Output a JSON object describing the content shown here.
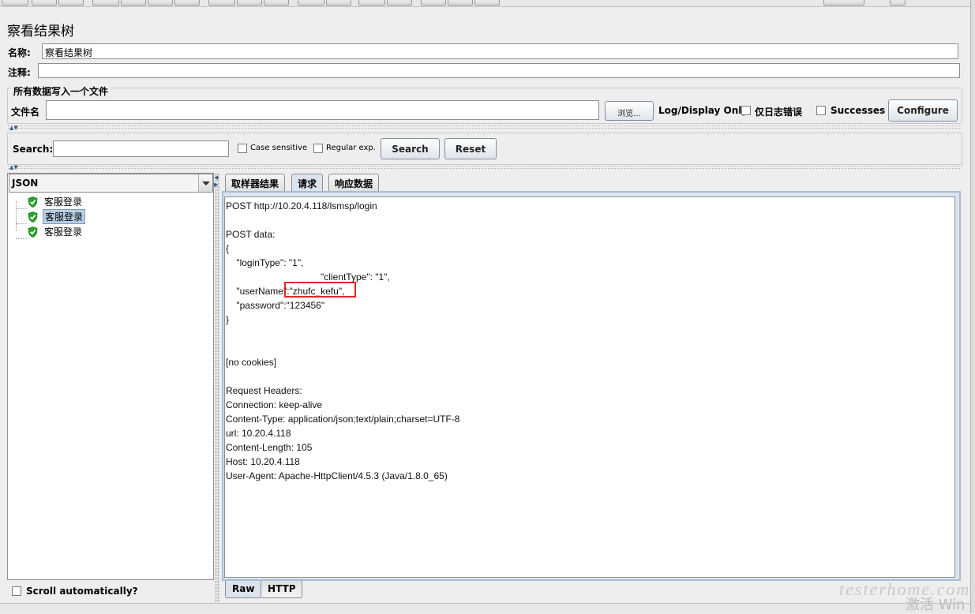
{
  "window_title": "察看结果树",
  "name_label": "名称:",
  "name_value": "察看结果树",
  "comment_label": "注释:",
  "comment_value": "",
  "file_section": {
    "legend": "所有数据写入一个文件",
    "filename_label": "文件名",
    "filename_value": "",
    "browse_label": "浏览...",
    "log_display_label": "Log/Display Only:",
    "errors_label": "仅日志错误",
    "successes_label": "Successes",
    "configure_label": "Configure"
  },
  "search": {
    "label": "Search:",
    "value": "",
    "case_sensitive": "Case sensitive",
    "regular_exp": "Regular exp.",
    "search_button": "Search",
    "reset_button": "Reset"
  },
  "renderer_select": "JSON",
  "tree_items": [
    "客服登录",
    "客服登录",
    "客服登录"
  ],
  "selected_index": 1,
  "scroll_auto_label": "Scroll automatically?",
  "tabs": [
    "取样器结果",
    "请求",
    "响应数据"
  ],
  "active_tab": "请求",
  "bottom_tabs": [
    "Raw",
    "HTTP"
  ],
  "request_text": "POST http://10.20.4.118/lsmsp/login\n\nPOST data:\n{\n    \"loginType\": \"1\",\n                                    \"clientType\": \"1\",\n    \"userName\":\"zhufc_kefu\",\n    \"password\":\"123456\"\n}\n\n\n[no cookies]\n\nRequest Headers:\nConnection: keep-alive\nContent-Type: application/json;text/plain;charset=UTF-8\nurl: 10.20.4.118\nContent-Length: 105\nHost: 10.20.4.118\nUser-Agent: Apache-HttpClient/4.5.3 (Java/1.8.0_65)",
  "watermark": "testerhome.com",
  "watermark2": "激活 Win"
}
